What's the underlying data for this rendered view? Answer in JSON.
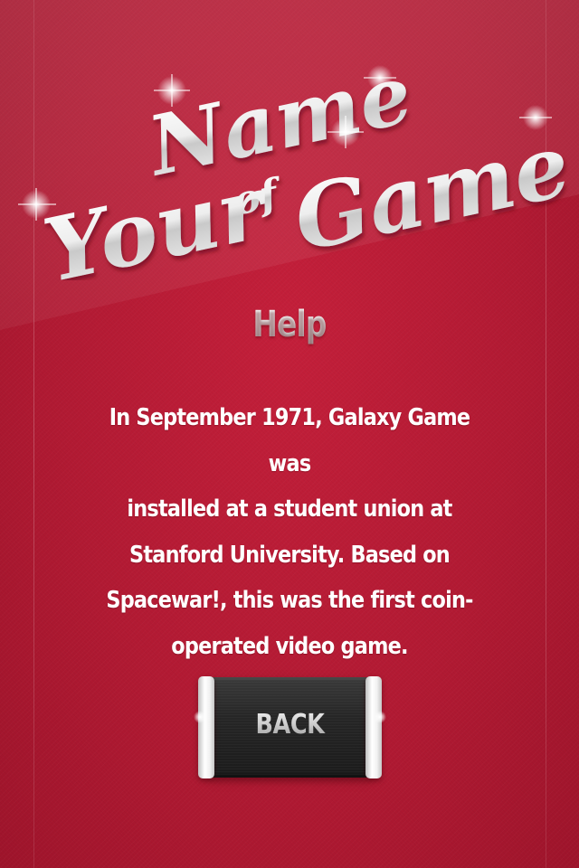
{
  "logo": {
    "word_name": "Name",
    "word_of": "of",
    "word_your": "Your",
    "word_game": "Game"
  },
  "help": {
    "title": "Help",
    "lines": [
      "In September 1971, Galaxy Game was",
      "installed at a student union at",
      "Stanford University. Based on",
      "Spacewar!, this was the first coin-",
      "operated video game."
    ]
  },
  "back_button": {
    "label": "BACK"
  },
  "colors": {
    "background": "#b51a32",
    "text": "#ffffff",
    "button": "#222222",
    "logo": "#e6e6e6"
  }
}
